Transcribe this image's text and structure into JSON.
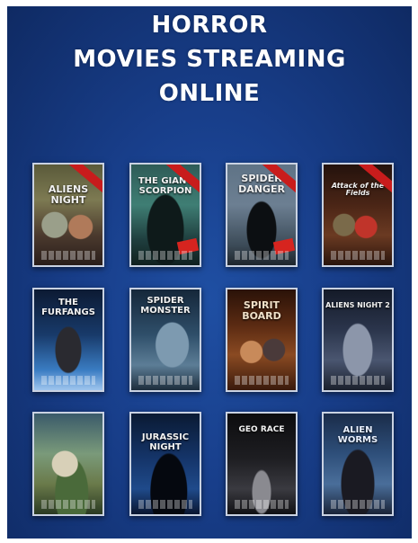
{
  "headline": {
    "line1": "HORROR",
    "line2": "MOVIES STREAMING",
    "line3": "ONLINE"
  },
  "colors": {
    "panel": "#183e8a",
    "frame": "#c9d2e2",
    "ribbon": "#c81c1c"
  },
  "posters": [
    {
      "title": "ALIENS NIGHT"
    },
    {
      "title": "THE GIANT SCORPION"
    },
    {
      "title": "SPIDER DANGER"
    },
    {
      "title": "Attack of the Fields"
    },
    {
      "title": "THE FURFANGS"
    },
    {
      "title": "SPIDER MONSTER"
    },
    {
      "title": "SPIRIT BOARD"
    },
    {
      "title": "ALIENS NIGHT 2"
    },
    {
      "title": ""
    },
    {
      "title": "JURASSIC NIGHT"
    },
    {
      "title": "GEO RACE"
    },
    {
      "title": "ALIEN WORMS"
    }
  ]
}
